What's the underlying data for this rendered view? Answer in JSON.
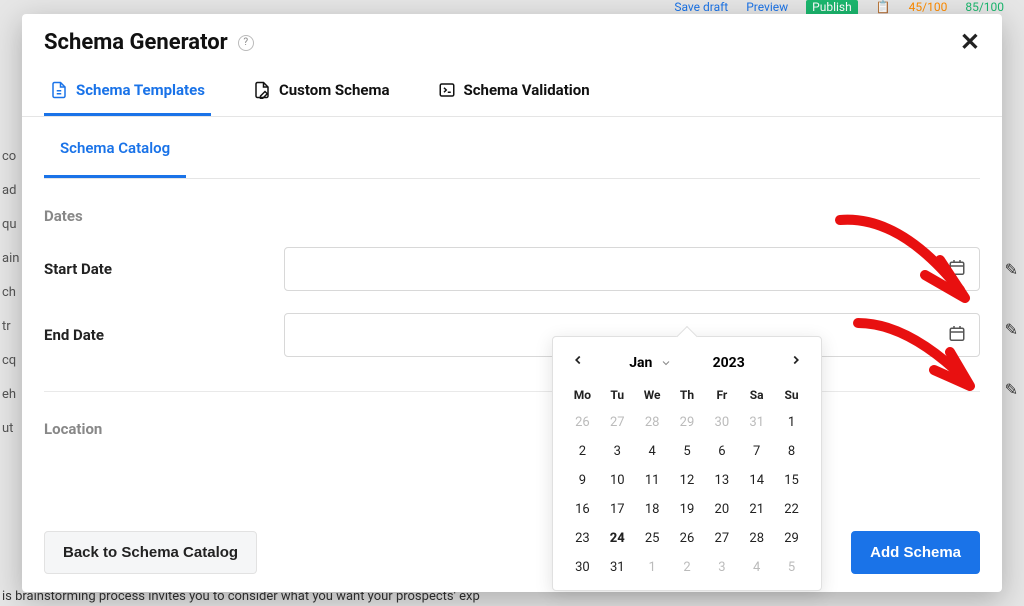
{
  "bg": {
    "save_draft": "Save draft",
    "preview": "Preview",
    "publish": "Publish",
    "score1": "45/100",
    "score2": "85/100",
    "side_items": [
      "co",
      "ad",
      "qu",
      "ain",
      "ch",
      "tr",
      "cq",
      "eh",
      "ut"
    ],
    "bottom_text": "is brainstorming process invites you to consider what you want your prospects' exp",
    "right_icons": [
      "✎",
      "✎",
      "✎"
    ]
  },
  "modal": {
    "title": "Schema Generator",
    "tabs": [
      {
        "label": "Schema Templates",
        "active": true
      },
      {
        "label": "Custom Schema",
        "active": false
      },
      {
        "label": "Schema Validation",
        "active": false
      }
    ],
    "subtab": "Schema Catalog",
    "section_dates": "Dates",
    "fields": {
      "start_label": "Start Date",
      "start_value": "",
      "end_label": "End Date",
      "end_value": ""
    },
    "section_location": "Location",
    "back_btn": "Back to Schema Catalog",
    "add_btn": "Add Schema"
  },
  "datepicker": {
    "month": "Jan",
    "year": "2023",
    "dow": [
      "Mo",
      "Tu",
      "We",
      "Th",
      "Fr",
      "Sa",
      "Su"
    ],
    "cells": [
      {
        "d": "26",
        "m": true
      },
      {
        "d": "27",
        "m": true
      },
      {
        "d": "28",
        "m": true
      },
      {
        "d": "29",
        "m": true
      },
      {
        "d": "30",
        "m": true
      },
      {
        "d": "31",
        "m": true
      },
      {
        "d": "1"
      },
      {
        "d": "2"
      },
      {
        "d": "3"
      },
      {
        "d": "4"
      },
      {
        "d": "5"
      },
      {
        "d": "6"
      },
      {
        "d": "7"
      },
      {
        "d": "8"
      },
      {
        "d": "9"
      },
      {
        "d": "10"
      },
      {
        "d": "11"
      },
      {
        "d": "12"
      },
      {
        "d": "13"
      },
      {
        "d": "14"
      },
      {
        "d": "15"
      },
      {
        "d": "16"
      },
      {
        "d": "17"
      },
      {
        "d": "18"
      },
      {
        "d": "19"
      },
      {
        "d": "20"
      },
      {
        "d": "21"
      },
      {
        "d": "22"
      },
      {
        "d": "23"
      },
      {
        "d": "24",
        "t": true
      },
      {
        "d": "25"
      },
      {
        "d": "26"
      },
      {
        "d": "27"
      },
      {
        "d": "28"
      },
      {
        "d": "29"
      },
      {
        "d": "30"
      },
      {
        "d": "31"
      },
      {
        "d": "1",
        "m": true
      },
      {
        "d": "2",
        "m": true
      },
      {
        "d": "3",
        "m": true
      },
      {
        "d": "4",
        "m": true
      },
      {
        "d": "5",
        "m": true
      }
    ]
  }
}
